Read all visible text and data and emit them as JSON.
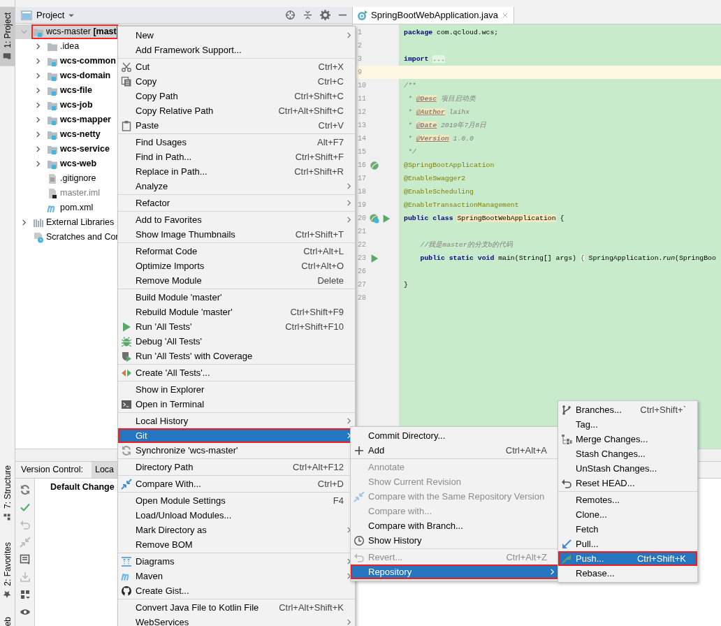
{
  "tool_window_bar": {
    "top": [
      {
        "label": "1: Project",
        "selected": true
      }
    ],
    "bottom": [
      {
        "label": "7: Structure",
        "selected": false
      },
      {
        "label": "2: Favorites",
        "selected": false
      },
      {
        "label": "eb",
        "selected": false
      }
    ]
  },
  "project_panel": {
    "title": "Project",
    "tree": [
      {
        "label": "wcs-master **[mast**",
        "kind": "root",
        "expanded": true,
        "selected": true,
        "outlined": true,
        "children": [
          {
            "label": ".idea",
            "kind": "folder",
            "expanded": false,
            "selected": false
          },
          {
            "label": "wcs-common",
            "kind": "module",
            "expanded": false,
            "selected": false
          },
          {
            "label": "wcs-domain",
            "kind": "module",
            "expanded": false,
            "selected": false
          },
          {
            "label": "wcs-file",
            "kind": "module",
            "expanded": false,
            "selected": false
          },
          {
            "label": "wcs-job",
            "kind": "module",
            "expanded": false,
            "selected": false
          },
          {
            "label": "wcs-mapper",
            "kind": "module",
            "expanded": false,
            "selected": false
          },
          {
            "label": "wcs-netty",
            "kind": "module",
            "expanded": false,
            "selected": false
          },
          {
            "label": "wcs-service",
            "kind": "module",
            "expanded": false,
            "selected": false
          },
          {
            "label": "wcs-web",
            "kind": "module",
            "expanded": false,
            "selected": false
          },
          {
            "label": ".gitignore",
            "kind": "file",
            "selected": false
          },
          {
            "label": "master.iml",
            "kind": "iml",
            "selected": false
          },
          {
            "label": "pom.xml",
            "kind": "maven",
            "selected": false
          }
        ]
      },
      {
        "label": "External Libraries",
        "kind": "libraries",
        "expanded": false,
        "selected": false
      },
      {
        "label": "Scratches and Cor",
        "kind": "scratches",
        "selected": false
      }
    ]
  },
  "editor": {
    "tabs": [
      {
        "label": "SpringBootWebApplication.java",
        "selected": true
      }
    ],
    "lines": [
      {
        "number": "1",
        "current": false,
        "tokens": [
          {
            "text": "package",
            "kind": "keyword"
          },
          {
            "text": " com.qcloud.wcs;",
            "kind": "plain"
          }
        ]
      },
      {
        "number": "2",
        "current": false
      },
      {
        "number": "3",
        "current": false,
        "tokens": [
          {
            "text": "import ",
            "kind": "keyword"
          },
          {
            "text": "...",
            "kind": "folded"
          }
        ]
      },
      {
        "number": "9",
        "current": true
      },
      {
        "number": "10",
        "current": false,
        "tokens": [
          {
            "text": "/**",
            "kind": "comment"
          }
        ]
      },
      {
        "number": "11",
        "current": false,
        "tokens": [
          {
            "text": " * ",
            "kind": "comment"
          },
          {
            "text": "@Desc",
            "kind": "doctag"
          },
          {
            "text": " 项目启动类",
            "kind": "comment"
          }
        ]
      },
      {
        "number": "12",
        "current": false,
        "tokens": [
          {
            "text": " * ",
            "kind": "comment"
          },
          {
            "text": "@Author",
            "kind": "doctag"
          },
          {
            "text": " laihx",
            "kind": "comment"
          }
        ]
      },
      {
        "number": "13",
        "current": false,
        "tokens": [
          {
            "text": " * ",
            "kind": "comment"
          },
          {
            "text": "@Date",
            "kind": "doctag"
          },
          {
            "text": " 2019年7月8日",
            "kind": "comment"
          }
        ]
      },
      {
        "number": "14",
        "current": false,
        "tokens": [
          {
            "text": " * ",
            "kind": "comment"
          },
          {
            "text": "@Version",
            "kind": "doctag"
          },
          {
            "text": " 1.0.0",
            "kind": "comment"
          }
        ]
      },
      {
        "number": "15",
        "current": false,
        "tokens": [
          {
            "text": " */",
            "kind": "comment"
          }
        ]
      },
      {
        "number": "16",
        "current": false,
        "tokens": [
          {
            "text": "@SpringBootApplication",
            "kind": "annotation"
          }
        ]
      },
      {
        "number": "17",
        "current": false,
        "tokens": [
          {
            "text": "@EnableSwagger2",
            "kind": "annotation"
          }
        ]
      },
      {
        "number": "18",
        "current": false,
        "tokens": [
          {
            "text": "@EnableScheduling",
            "kind": "annotation"
          }
        ]
      },
      {
        "number": "19",
        "current": false,
        "tokens": [
          {
            "text": "@EnableTransactionManagement",
            "kind": "annotation"
          }
        ]
      },
      {
        "number": "20",
        "current": false,
        "tokens": [
          {
            "text": "public class ",
            "kind": "keyword"
          },
          {
            "text": "SpringBootWebApplication",
            "kind": "usage"
          },
          {
            "text": " {",
            "kind": "plain"
          }
        ]
      },
      {
        "number": "21",
        "current": false
      },
      {
        "number": "22",
        "current": false,
        "tokens": [
          {
            "text": "    //我是master的分支b的代码",
            "kind": "comment"
          }
        ]
      },
      {
        "number": "23",
        "current": false,
        "tokens": [
          {
            "text": "    public static void ",
            "kind": "keyword"
          },
          {
            "text": "main(String[] args) ",
            "kind": "plain"
          },
          {
            "text": "{",
            "kind": "folded"
          },
          {
            "text": " SpringApplication.",
            "kind": "plain"
          },
          {
            "text": "run",
            "kind": "static"
          },
          {
            "text": "(SpringBoo",
            "kind": "plain"
          }
        ]
      },
      {
        "number": "26",
        "current": false
      },
      {
        "number": "27",
        "current": false,
        "tokens": [
          {
            "text": "}",
            "kind": "plain"
          }
        ]
      },
      {
        "number": "28",
        "current": false
      }
    ]
  },
  "version_control": {
    "title": "Version Control:",
    "tabs": [
      {
        "label": "Loca",
        "selected": true
      }
    ],
    "changelist": "Default Change"
  },
  "context_menu": {
    "sections": [
      {
        "items": [
          {
            "label": "New",
            "submenu": true,
            "selected": false
          },
          {
            "label": "Add Framework Support...",
            "submenu": false,
            "selected": false
          }
        ]
      },
      {
        "items": [
          {
            "label": "Cut",
            "submenu": false,
            "shortcut": "Ctrl+X",
            "selected": false
          },
          {
            "label": "Copy",
            "submenu": false,
            "shortcut": "Ctrl+C",
            "selected": false
          },
          {
            "label": "Copy Path",
            "submenu": false,
            "shortcut": "Ctrl+Shift+C",
            "selected": false
          },
          {
            "label": "Copy Relative Path",
            "submenu": false,
            "shortcut": "Ctrl+Alt+Shift+C",
            "selected": false
          },
          {
            "label": "Paste",
            "submenu": false,
            "shortcut": "Ctrl+V",
            "selected": false
          }
        ]
      },
      {
        "items": [
          {
            "label": "Find Usages",
            "submenu": false,
            "shortcut": "Alt+F7",
            "selected": false
          },
          {
            "label": "Find in Path...",
            "submenu": false,
            "shortcut": "Ctrl+Shift+F",
            "selected": false
          },
          {
            "label": "Replace in Path...",
            "submenu": false,
            "shortcut": "Ctrl+Shift+R",
            "selected": false
          },
          {
            "label": "Analyze",
            "submenu": true,
            "selected": false
          }
        ]
      },
      {
        "items": [
          {
            "label": "Refactor",
            "submenu": true,
            "selected": false
          }
        ]
      },
      {
        "items": [
          {
            "label": "Add to Favorites",
            "submenu": true,
            "selected": false
          },
          {
            "label": "Show Image Thumbnails",
            "submenu": false,
            "shortcut": "Ctrl+Shift+T",
            "selected": false
          }
        ]
      },
      {
        "items": [
          {
            "label": "Reformat Code",
            "submenu": false,
            "shortcut": "Ctrl+Alt+L",
            "selected": false
          },
          {
            "label": "Optimize Imports",
            "submenu": false,
            "shortcut": "Ctrl+Alt+O",
            "selected": false
          },
          {
            "label": "Remove Module",
            "submenu": false,
            "shortcut": "Delete",
            "selected": false
          }
        ]
      },
      {
        "items": [
          {
            "label": "Build Module 'master'",
            "submenu": false,
            "selected": false
          },
          {
            "label": "Rebuild Module 'master'",
            "submenu": false,
            "shortcut": "Ctrl+Shift+F9",
            "selected": false
          },
          {
            "label": "Run 'All Tests'",
            "submenu": false,
            "shortcut": "Ctrl+Shift+F10",
            "selected": false
          },
          {
            "label": "Debug 'All Tests'",
            "submenu": false,
            "selected": false
          },
          {
            "label": "Run 'All Tests' with Coverage",
            "submenu": false,
            "selected": false
          }
        ]
      },
      {
        "items": [
          {
            "label": "Create 'All Tests'...",
            "submenu": false,
            "selected": false
          }
        ]
      },
      {
        "items": [
          {
            "label": "Show in Explorer",
            "submenu": false,
            "selected": false
          },
          {
            "label": "Open in Terminal",
            "submenu": false,
            "selected": false
          }
        ]
      },
      {
        "items": [
          {
            "label": "Local History",
            "submenu": true,
            "selected": false
          },
          {
            "label": "Git",
            "submenu": true,
            "selected": true,
            "outlined": true
          },
          {
            "label": "Synchronize 'wcs-master'",
            "submenu": false,
            "selected": false
          }
        ]
      },
      {
        "items": [
          {
            "label": "Directory Path",
            "submenu": false,
            "shortcut": "Ctrl+Alt+F12",
            "selected": false
          }
        ]
      },
      {
        "items": [
          {
            "label": "Compare With...",
            "submenu": false,
            "shortcut": "Ctrl+D",
            "selected": false
          }
        ]
      },
      {
        "items": [
          {
            "label": "Open Module Settings",
            "submenu": false,
            "shortcut": "F4",
            "selected": false
          },
          {
            "label": "Load/Unload Modules...",
            "submenu": false,
            "selected": false
          },
          {
            "label": "Mark Directory as",
            "submenu": true,
            "selected": false
          },
          {
            "label": "Remove BOM",
            "submenu": false,
            "selected": false
          }
        ]
      },
      {
        "items": [
          {
            "label": "Diagrams",
            "submenu": true,
            "selected": false
          },
          {
            "label": "Maven",
            "submenu": true,
            "selected": false
          },
          {
            "label": "Create Gist...",
            "submenu": false,
            "selected": false
          }
        ]
      },
      {
        "items": [
          {
            "label": "Convert Java File to Kotlin File",
            "submenu": false,
            "shortcut": "Ctrl+Alt+Shift+K",
            "selected": false
          },
          {
            "label": "WebServices",
            "submenu": true,
            "selected": false
          }
        ]
      }
    ]
  },
  "git_menu": {
    "sections": [
      {
        "items": [
          {
            "label": "Commit Directory...",
            "submenu": false,
            "selected": false,
            "disabled": false
          },
          {
            "label": "Add",
            "submenu": false,
            "shortcut": "Ctrl+Alt+A",
            "selected": false,
            "disabled": false
          }
        ]
      },
      {
        "items": [
          {
            "label": "Annotate",
            "submenu": false,
            "selected": false,
            "disabled": true
          },
          {
            "label": "Show Current Revision",
            "submenu": false,
            "selected": false,
            "disabled": true
          },
          {
            "label": "Compare with the Same Repository Version",
            "submenu": false,
            "selected": false,
            "disabled": true
          },
          {
            "label": "Compare with...",
            "submenu": false,
            "selected": false,
            "disabled": true
          },
          {
            "label": "Compare with Branch...",
            "submenu": false,
            "selected": false,
            "disabled": false
          },
          {
            "label": "Show History",
            "submenu": false,
            "selected": false,
            "disabled": false
          }
        ]
      },
      {
        "items": [
          {
            "label": "Revert...",
            "submenu": false,
            "shortcut": "Ctrl+Alt+Z",
            "selected": false,
            "disabled": true
          },
          {
            "label": "Repository",
            "submenu": true,
            "selected": true,
            "disabled": false,
            "outlined": true
          }
        ]
      }
    ]
  },
  "repository_menu": {
    "sections": [
      {
        "items": [
          {
            "label": "Branches...",
            "submenu": false,
            "shortcut": "Ctrl+Shift+`",
            "selected": false
          },
          {
            "label": "Tag...",
            "submenu": false,
            "selected": false
          },
          {
            "label": "Merge Changes...",
            "submenu": false,
            "selected": false
          },
          {
            "label": "Stash Changes...",
            "submenu": false,
            "selected": false
          },
          {
            "label": "UnStash Changes...",
            "submenu": false,
            "selected": false
          },
          {
            "label": "Reset HEAD...",
            "submenu": false,
            "selected": false
          }
        ]
      },
      {
        "items": [
          {
            "label": "Remotes...",
            "submenu": false,
            "selected": false
          },
          {
            "label": "Clone...",
            "submenu": false,
            "selected": false
          },
          {
            "label": "Fetch",
            "submenu": false,
            "selected": false
          },
          {
            "label": "Pull...",
            "submenu": false,
            "selected": false
          },
          {
            "label": "Push...",
            "submenu": false,
            "shortcut": "Ctrl+Shift+K",
            "selected": true,
            "outlined": true
          },
          {
            "label": "Rebase...",
            "submenu": false,
            "selected": false
          }
        ]
      }
    ]
  }
}
